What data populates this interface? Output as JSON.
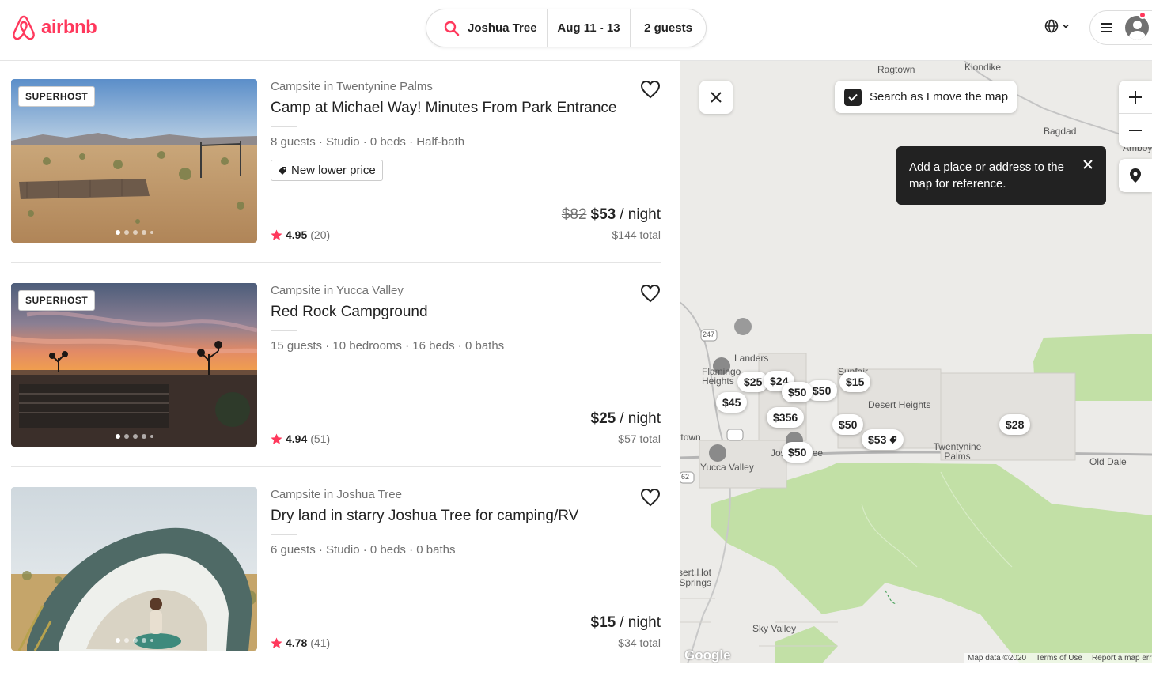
{
  "brand": {
    "name": "airbnb",
    "color": "#ff385c"
  },
  "search": {
    "location": "Joshua Tree",
    "dates": "Aug 11 - 13",
    "guests": "2 guests"
  },
  "listings": [
    {
      "superhost": "SUPERHOST",
      "subtitle": "Campsite in Twentynine Palms",
      "title": "Camp at Michael Way! Minutes From Park Entrance",
      "details": "8 guests · Studio · 0 beds · Half-bath",
      "badge": "New lower price",
      "rating": "4.95",
      "reviews": "(20)",
      "old_price": "$82",
      "price": "$53",
      "per": "/ night",
      "total": "$144 total"
    },
    {
      "superhost": "SUPERHOST",
      "subtitle": "Campsite in Yucca Valley",
      "title": "Red Rock Campground",
      "details": "15 guests · 10 bedrooms · 16 beds · 0 baths",
      "rating": "4.94",
      "reviews": "(51)",
      "price": "$25",
      "per": "/ night",
      "total": "$57 total"
    },
    {
      "subtitle": "Campsite in Joshua Tree",
      "title": "Dry land in starry Joshua Tree for camping/RV",
      "details": "6 guests · Studio · 0 beds · 0 baths",
      "rating": "4.78",
      "reviews": "(41)",
      "price": "$15",
      "per": "/ night",
      "total": "$34 total"
    }
  ],
  "map": {
    "search_toggle": "Search as I move the map",
    "tooltip": "Add a place or address to the map for reference.",
    "labels": [
      "Ragtown",
      "Klondike",
      "Bagdad",
      "Amboy",
      "Landers",
      "Flamingo Heights",
      "Sunfair",
      "Desert Heights",
      "Twentynine Palms",
      "Old Dale",
      "Yucca Valley",
      "Pioneertown",
      "Joshua Tree",
      "Desert Hot Springs",
      "Sky Valley",
      "247",
      "62"
    ],
    "price_pins": [
      "$25",
      "$24",
      "$50",
      "$50",
      "$15",
      "$45",
      "$356",
      "$50",
      "$53",
      "$28",
      "$50"
    ],
    "footer": {
      "google": "Google",
      "data": "Map data ©2020",
      "terms": "Terms of Use",
      "report": "Report a map error"
    }
  },
  "icons": [
    "search-icon",
    "globe-icon",
    "menu-icon",
    "avatar-icon",
    "heart-icon",
    "star-icon",
    "tag-icon",
    "close-icon",
    "check-icon",
    "plus-icon",
    "minus-icon",
    "pin-icon"
  ]
}
